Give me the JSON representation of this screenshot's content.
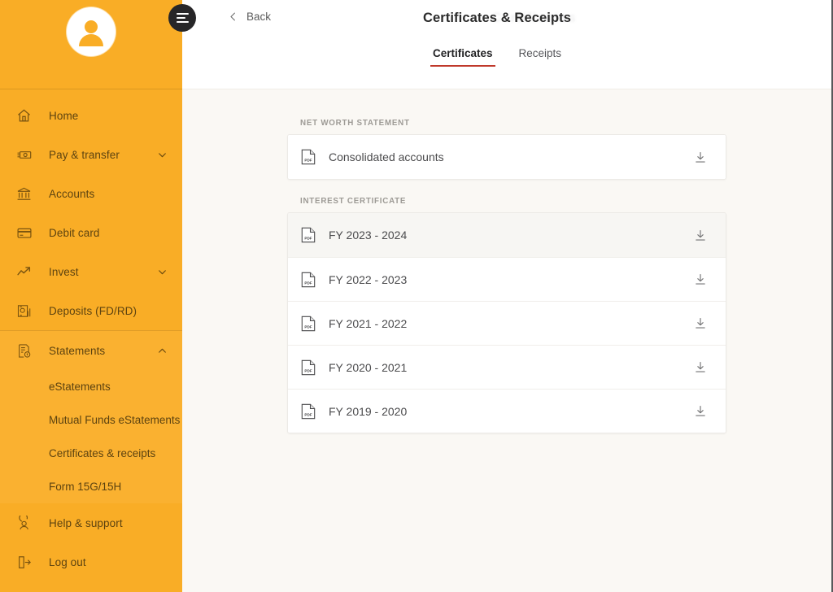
{
  "sidebar": {
    "avatar_alt": "User profile avatar",
    "items": [
      {
        "label": "Home",
        "icon": "home-icon",
        "expandable": false,
        "expanded": false
      },
      {
        "label": "Pay & transfer",
        "icon": "money-icon",
        "expandable": true,
        "expanded": false
      },
      {
        "label": "Accounts",
        "icon": "bank-icon",
        "expandable": false,
        "expanded": false
      },
      {
        "label": "Debit card",
        "icon": "card-icon",
        "expandable": false,
        "expanded": false
      },
      {
        "label": "Invest",
        "icon": "trend-up-icon",
        "expandable": true,
        "expanded": false
      },
      {
        "label": "Deposits (FD/RD)",
        "icon": "deposits-icon",
        "expandable": false,
        "expanded": false
      },
      {
        "label": "Statements",
        "icon": "statement-icon",
        "expandable": true,
        "expanded": true
      }
    ],
    "statements_children": [
      {
        "label": "eStatements"
      },
      {
        "label": "Mutual Funds eStatements"
      },
      {
        "label": "Certificates & receipts"
      },
      {
        "label": "Form 15G/15H"
      }
    ],
    "footer_items": [
      {
        "label": "Help & support",
        "icon": "support-icon"
      },
      {
        "label": "Log out",
        "icon": "logout-icon"
      }
    ]
  },
  "header": {
    "menu_label": "hamburger-menu",
    "back_label": "Back",
    "title": "Certificates & Receipts",
    "watermark": "Certificates"
  },
  "tabs": [
    {
      "label": "Certificates",
      "active": true
    },
    {
      "label": "Receipts",
      "active": false
    }
  ],
  "content": {
    "sections": [
      {
        "label": "NET WORTH STATEMENT",
        "rows": [
          {
            "name": "Consolidated accounts",
            "file_type": "PDF",
            "hover": false
          }
        ]
      },
      {
        "label": "INTEREST CERTIFICATE",
        "rows": [
          {
            "name": "FY 2023 - 2024",
            "file_type": "PDF",
            "hover": true
          },
          {
            "name": "FY 2022 - 2023",
            "file_type": "PDF",
            "hover": false
          },
          {
            "name": "FY 2021 - 2022",
            "file_type": "PDF",
            "hover": false
          },
          {
            "name": "FY 2020 - 2021",
            "file_type": "PDF",
            "hover": false
          },
          {
            "name": "FY 2019 - 2020",
            "file_type": "PDF",
            "hover": false
          }
        ]
      }
    ],
    "download_label": "Download"
  },
  "colors": {
    "sidebar_bg": "#f9ad26",
    "sidebar_bg_active": "#fab130",
    "sidebar_text": "#5d4310",
    "accent_underline": "#c0392b",
    "content_bg": "#faf8f4",
    "card_bg": "#ffffff",
    "menu_button_bg": "#272628"
  }
}
